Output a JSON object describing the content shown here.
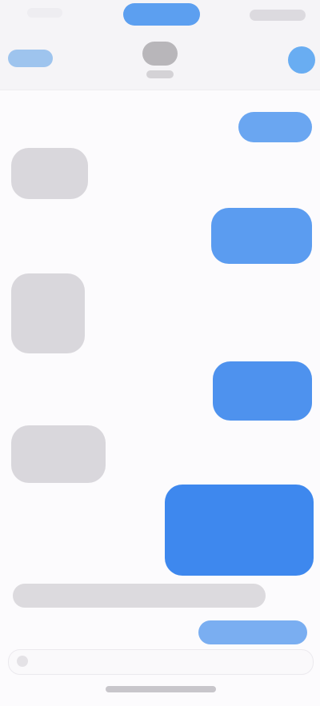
{
  "status_bar": {
    "time": "",
    "indicator": ""
  },
  "nav": {
    "back_label": "",
    "contact_name": ""
  },
  "messages": [
    {
      "direction": "outgoing",
      "text": ""
    },
    {
      "direction": "incoming",
      "text": ""
    },
    {
      "direction": "outgoing",
      "text": ""
    },
    {
      "direction": "incoming",
      "text": ""
    },
    {
      "direction": "outgoing",
      "text": ""
    },
    {
      "direction": "incoming",
      "text": ""
    },
    {
      "direction": "outgoing",
      "text": ""
    }
  ],
  "composer": {
    "reply_preview": "",
    "send_label": "",
    "placeholder": ""
  },
  "icons": {
    "back": "chevron-left-icon",
    "video": "video-camera-icon",
    "plus": "plus-icon"
  },
  "colors": {
    "accent": "#4b8ff0",
    "incoming_bubble": "#d9d7dc",
    "background": "#fcfbfd"
  }
}
